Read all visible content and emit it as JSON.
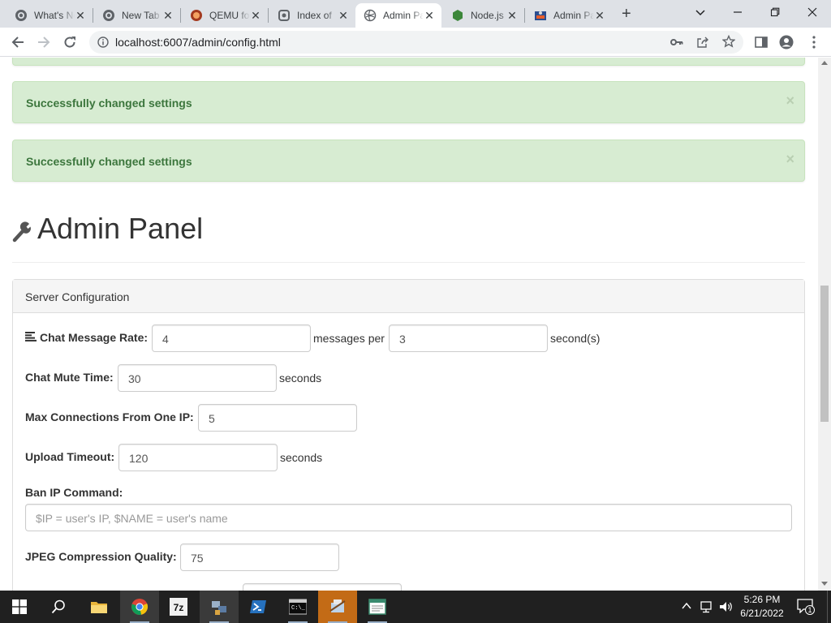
{
  "browser": {
    "tabs": [
      {
        "title": "What's New",
        "icon": "github-icon"
      },
      {
        "title": "New Tab",
        "icon": "github-icon"
      },
      {
        "title": "QEMU for Windows",
        "icon": "qemu-icon"
      },
      {
        "title": "Index of",
        "icon": "index-icon"
      },
      {
        "title": "Admin Panel",
        "icon": "globe-icon"
      },
      {
        "title": "Node.js",
        "icon": "nodejs-icon"
      },
      {
        "title": "Admin Panel",
        "icon": "cfg-icon"
      }
    ],
    "active_tab_index": 4,
    "new_tab_label": "+",
    "url": "localhost:6007/admin/config.html"
  },
  "alerts": [
    {
      "text": "Successfully changed settings",
      "close": "×"
    },
    {
      "text": "Successfully changed settings",
      "close": "×"
    }
  ],
  "page": {
    "title": "Admin Panel"
  },
  "panel": {
    "heading": "Server Configuration",
    "fields": {
      "chat_rate": {
        "label": "Chat Message Rate:",
        "value1": "4",
        "middle": "messages per",
        "value2": "3",
        "suffix": "second(s)"
      },
      "chat_mute": {
        "label": "Chat Mute Time:",
        "value": "30",
        "suffix": "seconds"
      },
      "max_conn": {
        "label": "Max Connections From One IP:",
        "value": "5"
      },
      "upload_timeout": {
        "label": "Upload Timeout:",
        "value": "120",
        "suffix": "seconds"
      },
      "ban_cmd": {
        "label": "Ban IP Command:",
        "placeholder": "$IP = user's IP, $NAME = user's name"
      },
      "jpeg_quality": {
        "label": "JPEG Compression Quality:",
        "value": "75"
      }
    }
  },
  "taskbar": {
    "time": "5:26 PM",
    "date": "6/21/2022",
    "notification_count": "1",
    "apps": [
      "file-explorer-icon",
      "chrome-icon",
      "7zip-icon",
      "network-app-icon",
      "powershell-icon",
      "terminal-icon",
      "qemu-icon",
      "notepad-icon"
    ]
  },
  "colors": {
    "alert_bg": "#d7ecd2",
    "alert_text": "#3c763d",
    "taskbar": "#202020",
    "tabstrip": "#dee1e6"
  }
}
